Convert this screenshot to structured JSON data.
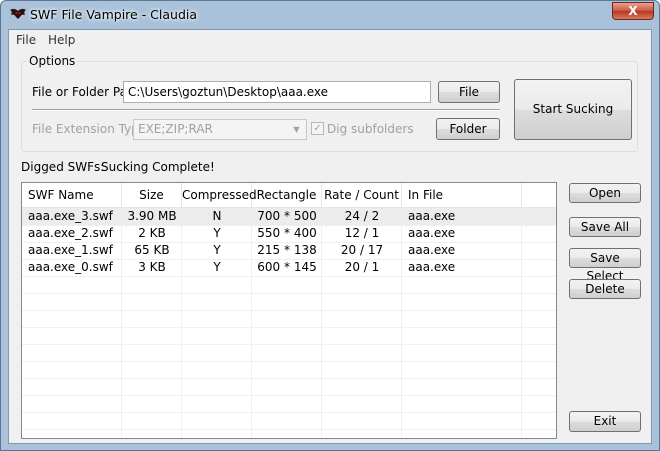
{
  "window": {
    "title": "SWF File Vampire - Claudia",
    "close_glyph": "X"
  },
  "menu": {
    "items": [
      "File",
      "Help"
    ]
  },
  "options": {
    "legend": "Options",
    "path_label": "File or Folder Path",
    "path_value": "C:\\Users\\goztun\\Desktop\\aaa.exe",
    "file_button": "File",
    "folder_button": "Folder",
    "ext_label": "File Extension Type:",
    "ext_value": "EXE;ZIP;RAR",
    "dig_subfolders_label": "Dig subfolders",
    "dig_subfolders_checked": true,
    "start_button": "Start Sucking"
  },
  "status": {
    "label": "Digged SWFs:",
    "text": "Sucking Complete!"
  },
  "table": {
    "columns": [
      "SWF Name",
      "Size",
      "Compressed",
      "Rectangle",
      "Rate / Count",
      "In File"
    ],
    "rows": [
      [
        "aaa.exe_3.swf",
        "3.90 MB",
        "N",
        "700 * 500",
        "24 / 2",
        "aaa.exe"
      ],
      [
        "aaa.exe_2.swf",
        "2 KB",
        "Y",
        "550 * 400",
        "12 / 1",
        "aaa.exe"
      ],
      [
        "aaa.exe_1.swf",
        "65 KB",
        "Y",
        "215 * 138",
        "20 / 17",
        "aaa.exe"
      ],
      [
        "aaa.exe_0.swf",
        "3 KB",
        "Y",
        "600 * 145",
        "20 / 1",
        "aaa.exe"
      ]
    ]
  },
  "actions": {
    "open": "Open",
    "save_all": "Save All",
    "save_select": "Save Select",
    "delete": "Delete",
    "exit": "Exit"
  },
  "colors": {
    "frame": "#a9c2d9",
    "client": "#f0f0f0",
    "close": "#c8553f",
    "selected_row": "#ececec"
  },
  "icons": {
    "app": "bat-icon",
    "close": "close-icon",
    "dropdown": "chevron-down-icon",
    "check": "checkmark-icon"
  }
}
